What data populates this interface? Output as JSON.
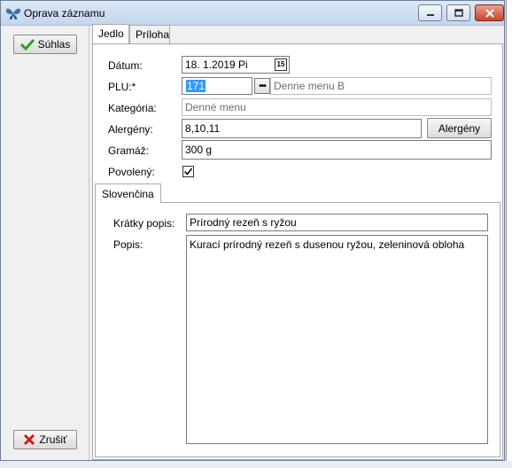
{
  "window": {
    "title": "Oprava záznamu"
  },
  "left_panel": {
    "ok_label": "Súhlas",
    "cancel_label": "Zrušiť"
  },
  "tabs": [
    {
      "label": "Jedlo",
      "active": true
    },
    {
      "label": "Príloha",
      "active": false
    }
  ],
  "form": {
    "date_label": "Dátum:",
    "date_value": "18. 1.2019  Pi",
    "plu_label": "PLU:*",
    "plu_value": "171",
    "plu_name": "Denne menu B",
    "category_label": "Kategória:",
    "category_value": "Denné menu",
    "allergens_label": "Alergény:",
    "allergens_value": "8,10,11",
    "allergens_button": "Alergény",
    "weight_label": "Gramáž:",
    "weight_value": "300 g",
    "enabled_label": "Povolený:",
    "enabled_checked": true
  },
  "language_tab": {
    "label": "Slovenčina",
    "short_desc_label": "Krátky popis:",
    "short_desc_value": "Prírodný rezeň s ryžou",
    "desc_label": "Popis:",
    "desc_value": "Kurací prírodný rezeň s dusenou ryžou, zeleninová obloha"
  },
  "colors": {
    "ok_check": "#2e9e2e",
    "cancel_x": "#cc1b1b",
    "close_button": "#c9452c",
    "selection": "#3399ff"
  }
}
